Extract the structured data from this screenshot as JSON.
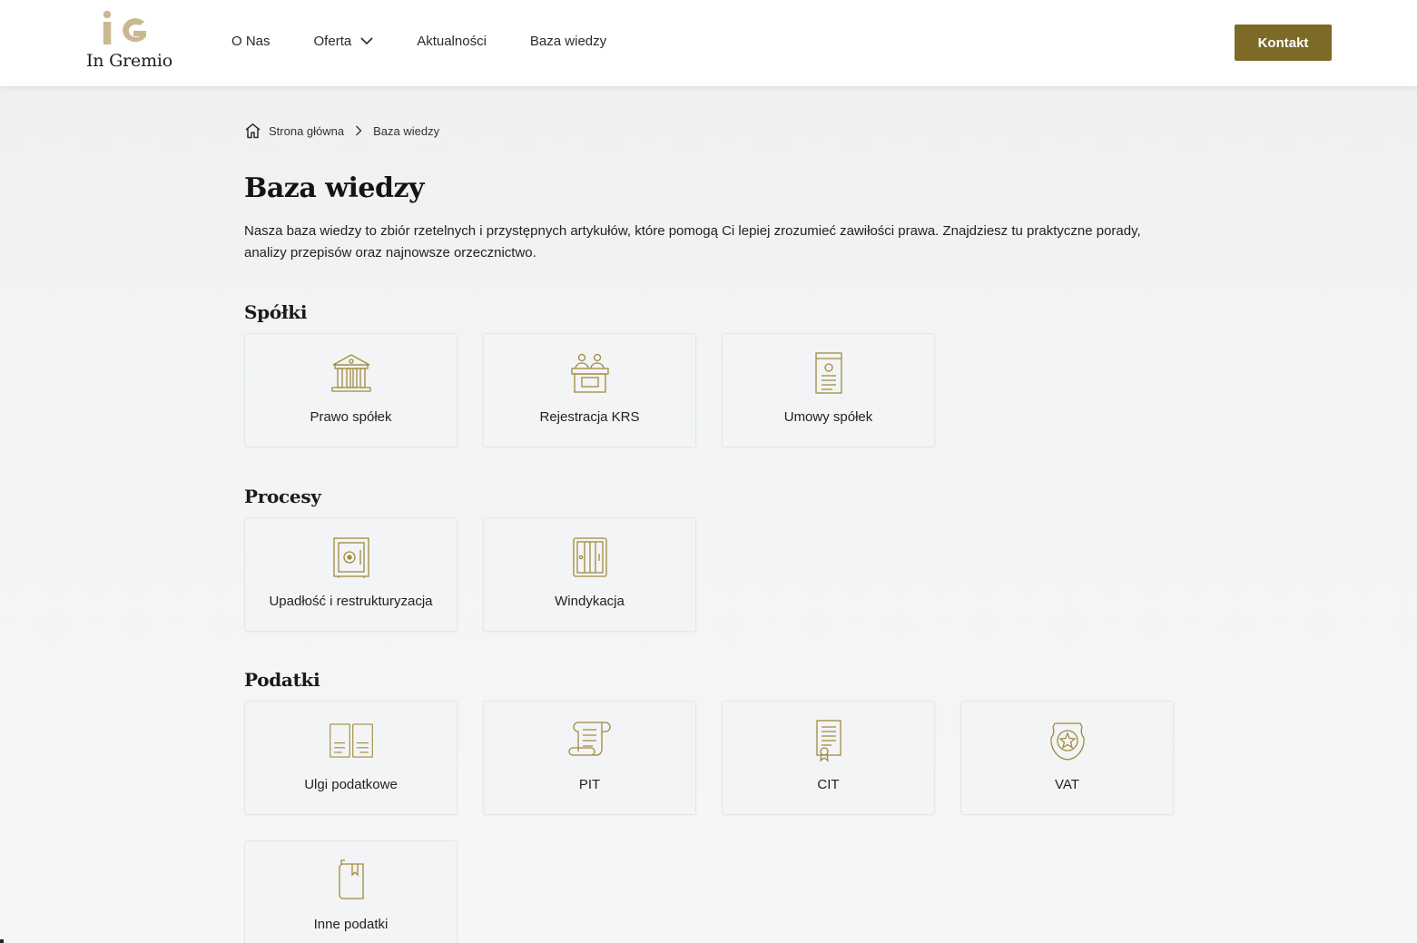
{
  "brand": {
    "name": "In Gremio",
    "accent": "#7d6a26",
    "logo_color": "#c9b991"
  },
  "nav": {
    "items": [
      {
        "label": "O Nas"
      },
      {
        "label": "Oferta"
      },
      {
        "label": "Aktualności"
      },
      {
        "label": "Baza wiedzy"
      }
    ],
    "contact_label": "Kontakt"
  },
  "breadcrumb": {
    "home": "Strona główna",
    "current": "Baza wiedzy"
  },
  "page": {
    "title": "Baza wiedzy",
    "intro": "Nasza baza wiedzy to zbiór rzetelnych i przystępnych artykułów, które pomogą Ci lepiej zrozumieć zawiłości prawa. Znajdziesz tu praktyczne porady, analizy przepisów oraz najnowsze orzecznictwo."
  },
  "sections": [
    {
      "title": "Spółki",
      "cards": [
        {
          "label": "Prawo spółek",
          "icon": "courthouse-icon"
        },
        {
          "label": "Rejestracja KRS",
          "icon": "registration-desk-icon"
        },
        {
          "label": "Umowy spółek",
          "icon": "contract-document-icon"
        }
      ]
    },
    {
      "title": "Procesy",
      "cards": [
        {
          "label": "Upadłość i restrukturyzacja",
          "icon": "safe-icon"
        },
        {
          "label": "Windykacja",
          "icon": "cabinet-icon"
        }
      ]
    },
    {
      "title": "Podatki",
      "cards": [
        {
          "label": "Ulgi podatkowe",
          "icon": "open-book-icon"
        },
        {
          "label": "PIT",
          "icon": "scroll-icon"
        },
        {
          "label": "CIT",
          "icon": "certificate-icon"
        },
        {
          "label": "VAT",
          "icon": "star-badge-icon"
        },
        {
          "label": "Inne podatki",
          "icon": "bookmark-book-icon"
        }
      ]
    }
  ]
}
